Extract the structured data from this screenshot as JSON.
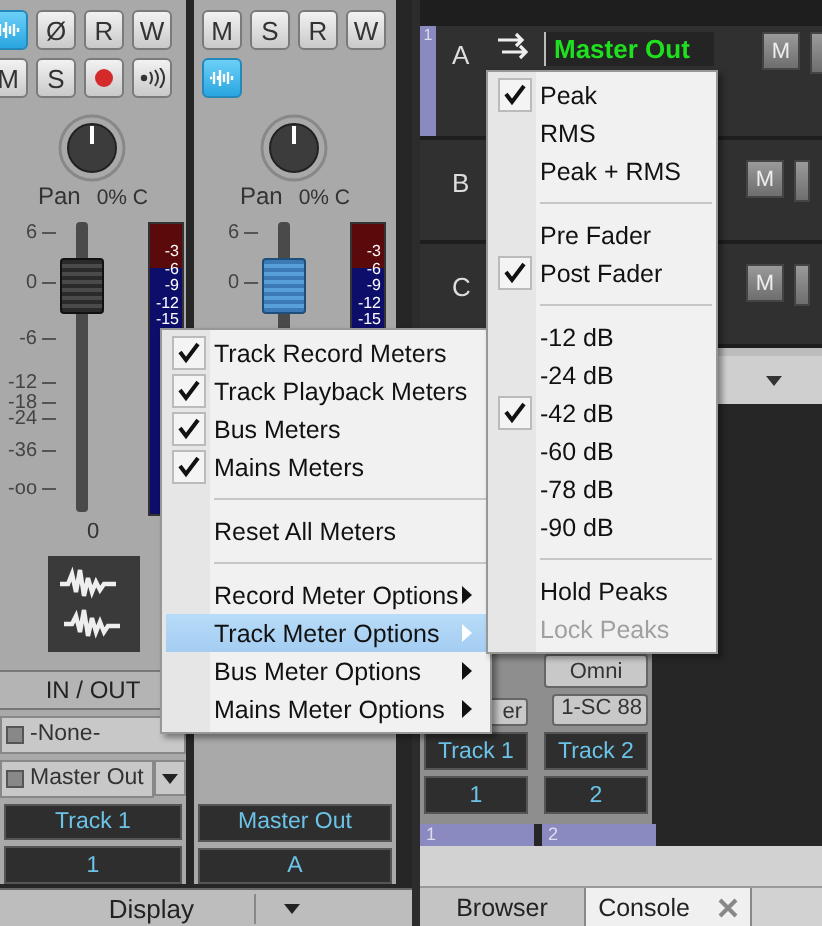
{
  "strips": [
    {
      "buttons": [
        {
          "kind": "wave",
          "on": true
        },
        {
          "kind": "text",
          "label": "Ø"
        },
        {
          "kind": "text",
          "label": "R"
        },
        {
          "kind": "text",
          "label": "W"
        },
        {
          "kind": "text",
          "label": "M"
        },
        {
          "kind": "text",
          "label": "S"
        },
        {
          "kind": "record"
        },
        {
          "kind": "speaker"
        }
      ],
      "pan_label": "Pan",
      "pan_value": "0% C",
      "scale": [
        "6",
        "0",
        "-6",
        "-12",
        "-18",
        "-24",
        "-36",
        "-oo"
      ],
      "meter_scale": [
        "-3",
        "-6",
        "-9",
        "-12",
        "-15"
      ],
      "fader_value": "0",
      "selected": false,
      "io": {
        "title": "IN / OUT",
        "input": "-None-",
        "output": "Master Out"
      },
      "name": "Track 1",
      "number": "1"
    },
    {
      "buttons": [
        {
          "kind": "text",
          "label": "M"
        },
        {
          "kind": "text",
          "label": "S"
        },
        {
          "kind": "text",
          "label": "R"
        },
        {
          "kind": "text",
          "label": "W"
        },
        {
          "kind": "wave",
          "on": true
        }
      ],
      "pan_label": "Pan",
      "pan_value": "0% C",
      "scale": [
        "6",
        "0"
      ],
      "meter_scale": [
        "-3",
        "-6",
        "-9",
        "-12",
        "-15"
      ],
      "selected": true,
      "name": "Master Out",
      "number": "A"
    }
  ],
  "display_button": "Display",
  "tracks": [
    {
      "number": "1",
      "letter": "A",
      "output": "Master Out",
      "buttons": [
        "M"
      ]
    },
    {
      "letter": "B",
      "buttons": [
        "M"
      ]
    },
    {
      "letter": "C",
      "buttons": [
        "M"
      ]
    }
  ],
  "mini_strips": [
    {
      "output": "er",
      "name": "Track 1",
      "number": "1",
      "lane": "1"
    },
    {
      "input": "Omni",
      "output": "1-SC 88",
      "name": "Track 2",
      "number": "2",
      "lane": "2"
    }
  ],
  "tabs": [
    {
      "label": "Browser",
      "selected": false,
      "closable": false
    },
    {
      "label": "Console",
      "selected": true,
      "closable": true
    }
  ],
  "menu": [
    {
      "kind": "check",
      "label": "Track Record Meters",
      "checked": true,
      "selected": false
    },
    {
      "kind": "check",
      "label": "Track Playback Meters",
      "checked": true,
      "selected": false
    },
    {
      "kind": "check",
      "label": "Bus Meters",
      "checked": true,
      "selected": false
    },
    {
      "kind": "check",
      "label": "Mains Meters",
      "checked": true,
      "selected": false
    },
    {
      "kind": "separator"
    },
    {
      "kind": "command",
      "label": "Reset All Meters",
      "selected": false
    },
    {
      "kind": "separator"
    },
    {
      "kind": "submenu",
      "label": "Record Meter Options",
      "selected": false
    },
    {
      "kind": "submenu",
      "label": "Track Meter Options",
      "selected": true
    },
    {
      "kind": "submenu",
      "label": "Bus Meter Options",
      "selected": false
    },
    {
      "kind": "submenu",
      "label": "Mains Meter Options",
      "selected": false
    }
  ],
  "submenu": [
    {
      "kind": "check",
      "label": "Peak",
      "checked": true
    },
    {
      "kind": "check",
      "label": "RMS",
      "checked": false
    },
    {
      "kind": "check",
      "label": "Peak + RMS",
      "checked": false
    },
    {
      "kind": "separator"
    },
    {
      "kind": "check",
      "label": "Pre Fader",
      "checked": false
    },
    {
      "kind": "check",
      "label": "Post Fader",
      "checked": true
    },
    {
      "kind": "separator"
    },
    {
      "kind": "check",
      "label": "-12 dB",
      "checked": false
    },
    {
      "kind": "check",
      "label": "-24 dB",
      "checked": false
    },
    {
      "kind": "check",
      "label": "-42 dB",
      "checked": true
    },
    {
      "kind": "check",
      "label": "-60 dB",
      "checked": false
    },
    {
      "kind": "check",
      "label": "-78 dB",
      "checked": false
    },
    {
      "kind": "check",
      "label": "-90 dB",
      "checked": false
    },
    {
      "kind": "separator"
    },
    {
      "kind": "command",
      "label": "Hold Peaks",
      "disabled": false
    },
    {
      "kind": "command",
      "label": "Lock Peaks",
      "disabled": true
    }
  ]
}
